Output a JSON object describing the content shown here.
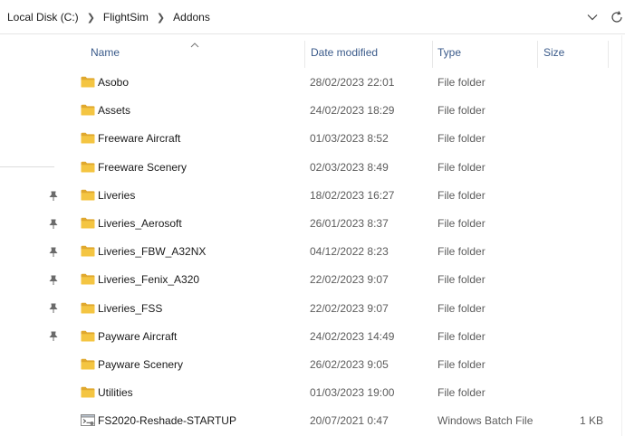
{
  "address_bar": {
    "crumbs": [
      "Local Disk (C:)",
      "FlightSim",
      "Addons"
    ],
    "dropdown_icon": "chevron-down-icon",
    "refresh_icon": "refresh-icon"
  },
  "columns": {
    "name": "Name",
    "date": "Date modified",
    "type": "Type",
    "size": "Size",
    "sorted_by": "name"
  },
  "items": [
    {
      "name": "Asobo",
      "date": "28/02/2023 22:01",
      "type": "File folder",
      "size": "",
      "icon": "folder-icon"
    },
    {
      "name": "Assets",
      "date": "24/02/2023 18:29",
      "type": "File folder",
      "size": "",
      "icon": "folder-icon"
    },
    {
      "name": "Freeware Aircraft",
      "date": "01/03/2023 8:52",
      "type": "File folder",
      "size": "",
      "icon": "folder-icon"
    },
    {
      "name": "Freeware Scenery",
      "date": "02/03/2023 8:49",
      "type": "File folder",
      "size": "",
      "icon": "folder-icon"
    },
    {
      "name": "Liveries",
      "date": "18/02/2023 16:27",
      "type": "File folder",
      "size": "",
      "icon": "folder-icon"
    },
    {
      "name": "Liveries_Aerosoft",
      "date": "26/01/2023 8:37",
      "type": "File folder",
      "size": "",
      "icon": "folder-icon"
    },
    {
      "name": "Liveries_FBW_A32NX",
      "date": "04/12/2022 8:23",
      "type": "File folder",
      "size": "",
      "icon": "folder-icon"
    },
    {
      "name": "Liveries_Fenix_A320",
      "date": "22/02/2023 9:07",
      "type": "File folder",
      "size": "",
      "icon": "folder-icon"
    },
    {
      "name": "Liveries_FSS",
      "date": "22/02/2023 9:07",
      "type": "File folder",
      "size": "",
      "icon": "folder-icon"
    },
    {
      "name": "Payware Aircraft",
      "date": "24/02/2023 14:49",
      "type": "File folder",
      "size": "",
      "icon": "folder-icon"
    },
    {
      "name": "Payware Scenery",
      "date": "26/02/2023 9:05",
      "type": "File folder",
      "size": "",
      "icon": "folder-icon"
    },
    {
      "name": "Utilities",
      "date": "01/03/2023 19:00",
      "type": "File folder",
      "size": "",
      "icon": "folder-icon"
    },
    {
      "name": "FS2020-Reshade-STARTUP",
      "date": "20/07/2021 0:47",
      "type": "Windows Batch File",
      "size": "1 KB",
      "icon": "batch-file-icon"
    }
  ],
  "nav_pins": [
    "pin-icon",
    "pin-icon",
    "pin-icon",
    "pin-icon",
    "pin-icon",
    "pin-icon"
  ],
  "colors": {
    "folder": "#f4c542",
    "folder_dark": "#e0a82e",
    "header_text": "#3a5a8a",
    "meta_text": "#5c5c5c"
  }
}
